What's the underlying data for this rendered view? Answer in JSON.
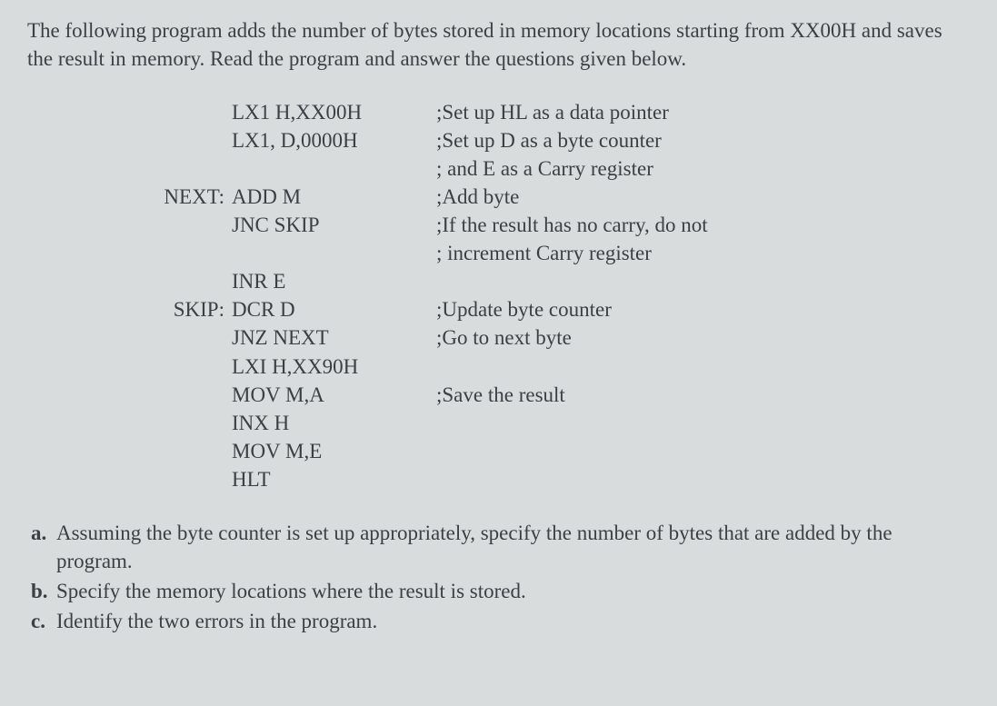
{
  "intro": "The following program adds the number of bytes stored in memory locations starting from XX00H and saves the result in memory. Read the program and answer the questions given below.",
  "code": [
    {
      "label": "",
      "instr": "LX1 H,XX00H",
      "comment": ";Set up HL as a data pointer"
    },
    {
      "label": "",
      "instr": "LX1, D,0000H",
      "comment": ";Set up D as a byte counter"
    },
    {
      "label": "",
      "instr": "",
      "comment": ";   and E as a Carry register"
    },
    {
      "label": "NEXT:",
      "instr": "ADD M",
      "comment": ";Add byte"
    },
    {
      "label": "",
      "instr": "JNC SKIP",
      "comment": ";If the result has no carry, do not"
    },
    {
      "label": "",
      "instr": "",
      "comment": ";   increment Carry register"
    },
    {
      "label": "",
      "instr": "INR E",
      "comment": ""
    },
    {
      "label": "SKIP:",
      "instr": "DCR D",
      "comment": ";Update byte counter"
    },
    {
      "label": "",
      "instr": "JNZ NEXT",
      "comment": ";Go to next byte"
    },
    {
      "label": "",
      "instr": "LXI H,XX90H",
      "comment": ""
    },
    {
      "label": "",
      "instr": "MOV M,A",
      "comment": ";Save the result"
    },
    {
      "label": "",
      "instr": "INX H",
      "comment": ""
    },
    {
      "label": "",
      "instr": "MOV M,E",
      "comment": ""
    },
    {
      "label": "",
      "instr": "HLT",
      "comment": ""
    }
  ],
  "questions": [
    {
      "label": "a.",
      "text": "Assuming the byte counter is set up appropriately, specify the number of bytes that are added by the program."
    },
    {
      "label": "b.",
      "text": "Specify the memory locations where the result is stored."
    },
    {
      "label": "c.",
      "text": "Identify the two errors in the program."
    }
  ]
}
